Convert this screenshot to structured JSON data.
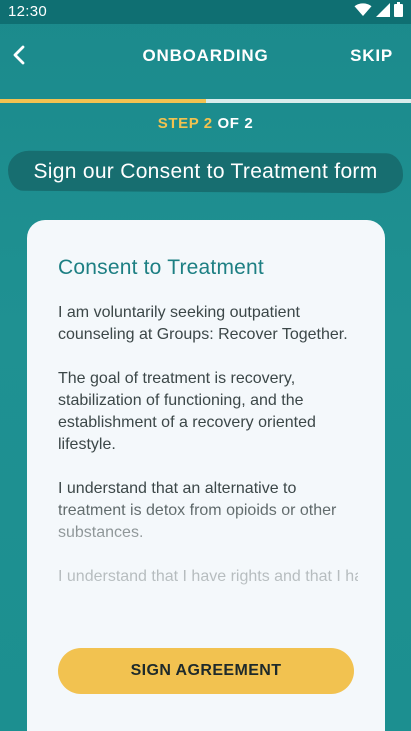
{
  "status_bar": {
    "time": "12:30",
    "icons": [
      "wifi-icon",
      "cellular-signal-icon",
      "battery-icon"
    ]
  },
  "app_bar": {
    "back_icon": "chevron-left-icon",
    "title": "ONBOARDING",
    "skip_label": "SKIP"
  },
  "progress": {
    "current_step": 2,
    "total_steps": 2,
    "fill_fraction": 0.5,
    "step_prefix": "STEP 2",
    "step_suffix": " OF 2"
  },
  "banner": {
    "text": "Sign our Consent to Treatment form"
  },
  "card": {
    "title": "Consent to Treatment",
    "paragraphs": [
      "I am voluntarily seeking outpatient counseling at Groups: Recover Together.",
      "The goal of treatment is recovery, stabilization of functioning, and the establishment of a recovery oriented lifestyle.",
      "I understand that an alternative to treatment is detox from opioids or other substances.",
      "I understand that I have rights and that I have full responsibility to do someth..."
    ],
    "sign_button_label": "SIGN AGREEMENT"
  },
  "colors": {
    "background": "#1f8e8f",
    "status_bar": "#0f6f72",
    "accent_yellow": "#f2c250",
    "card": "#f4f8fb",
    "card_title": "#1d7f83",
    "banner": "#176e70"
  }
}
